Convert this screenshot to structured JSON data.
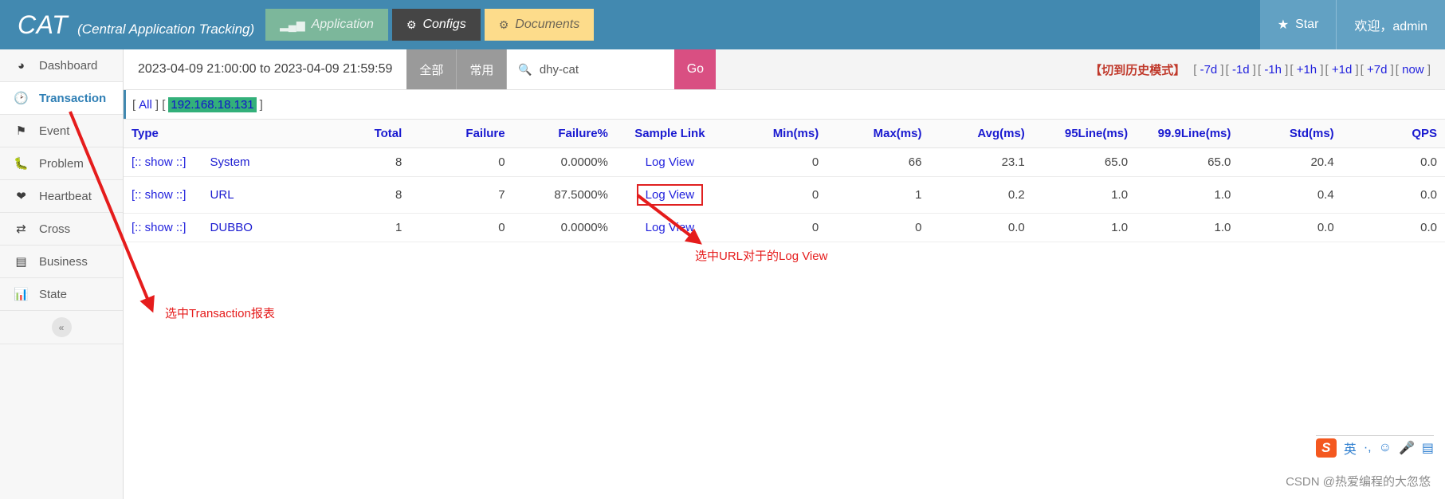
{
  "header": {
    "brand_name": "CAT",
    "brand_subtitle": "(Central Application Tracking)",
    "nav": [
      {
        "label": "Application",
        "icon": "bar-chart-icon",
        "state": "muted"
      },
      {
        "label": "Configs",
        "icon": "gears-icon",
        "state": "dark"
      },
      {
        "label": "Documents",
        "icon": "gears-icon",
        "state": "yellow"
      }
    ],
    "star_label": "Star",
    "star_icon": "star-icon",
    "welcome_label": "欢迎，admin"
  },
  "sidebar": {
    "items": [
      {
        "label": "Dashboard",
        "icon": "dashboard-icon"
      },
      {
        "label": "Transaction",
        "icon": "clock-icon"
      },
      {
        "label": "Event",
        "icon": "flag-icon"
      },
      {
        "label": "Problem",
        "icon": "bug-icon"
      },
      {
        "label": "Heartbeat",
        "icon": "heart-icon"
      },
      {
        "label": "Cross",
        "icon": "shuffle-icon"
      },
      {
        "label": "Business",
        "icon": "list-icon"
      },
      {
        "label": "State",
        "icon": "bar-chart-icon"
      }
    ],
    "active_index": 1,
    "collapse_icon": "chevron-double-left-icon"
  },
  "toolbar": {
    "date_range": "2023-04-09 21:00:00 to 2023-04-09 21:59:59",
    "seg_all": "全部",
    "seg_common": "常用",
    "search_value": "dhy-cat",
    "search_icon": "search-icon",
    "go_label": "Go",
    "history_mode": "【切到历史模式】",
    "time_links": [
      "-7d",
      "-1d",
      "-1h",
      "+1h",
      "+1d",
      "+7d",
      "now"
    ]
  },
  "filter": {
    "all_label": "All",
    "ip_label": "192.168.18.131",
    "bracket_open": "[",
    "bracket_close": "]"
  },
  "table": {
    "columns": [
      {
        "key": "type",
        "label": "Type",
        "align": "left"
      },
      {
        "key": "total",
        "label": "Total",
        "align": "right"
      },
      {
        "key": "failure",
        "label": "Failure",
        "align": "right"
      },
      {
        "key": "failurep",
        "label": "Failure%",
        "align": "right"
      },
      {
        "key": "sample",
        "label": "Sample Link",
        "align": "center"
      },
      {
        "key": "min",
        "label": "Min(ms)",
        "align": "right"
      },
      {
        "key": "max",
        "label": "Max(ms)",
        "align": "right"
      },
      {
        "key": "avg",
        "label": "Avg(ms)",
        "align": "right"
      },
      {
        "key": "line95",
        "label": "95Line(ms)",
        "align": "right"
      },
      {
        "key": "line999",
        "label": "99.9Line(ms)",
        "align": "right"
      },
      {
        "key": "std",
        "label": "Std(ms)",
        "align": "right"
      },
      {
        "key": "qps",
        "label": "QPS",
        "align": "right"
      }
    ],
    "show_link_label": "[:: show ::]",
    "sample_link_label": "Log View",
    "rows": [
      {
        "type": "System",
        "total": "8",
        "failure": "0",
        "failurep": "0.0000%",
        "sample": "Log View",
        "min": "0",
        "max": "66",
        "avg": "23.1",
        "line95": "65.0",
        "line999": "65.0",
        "std": "20.4",
        "qps": "0.0",
        "highlight": false
      },
      {
        "type": "URL",
        "total": "8",
        "failure": "7",
        "failurep": "87.5000%",
        "sample": "Log View",
        "min": "0",
        "max": "1",
        "avg": "0.2",
        "line95": "1.0",
        "line999": "1.0",
        "std": "0.4",
        "qps": "0.0",
        "highlight": true
      },
      {
        "type": "DUBBO",
        "total": "1",
        "failure": "0",
        "failurep": "0.0000%",
        "sample": "Log View",
        "min": "0",
        "max": "0",
        "avg": "0.0",
        "line95": "1.0",
        "line999": "1.0",
        "std": "0.0",
        "qps": "0.0",
        "highlight": false
      }
    ]
  },
  "annotations": [
    {
      "text": "选中Transaction报表",
      "color": "#e51c1c"
    },
    {
      "text": "选中URL对于的Log View",
      "color": "#e51c1c"
    }
  ],
  "ime": {
    "logo": "S",
    "items": [
      "英",
      "·,",
      "☺",
      "🎤",
      "▤"
    ]
  },
  "watermark": "CSDN @热爱编程的大忽悠",
  "colors": {
    "brand_blue": "#4289b0",
    "accent_pink": "#d94f82",
    "link_blue": "#2222dd",
    "annotation_red": "#e51c1c",
    "ip_green": "#33b07a"
  }
}
